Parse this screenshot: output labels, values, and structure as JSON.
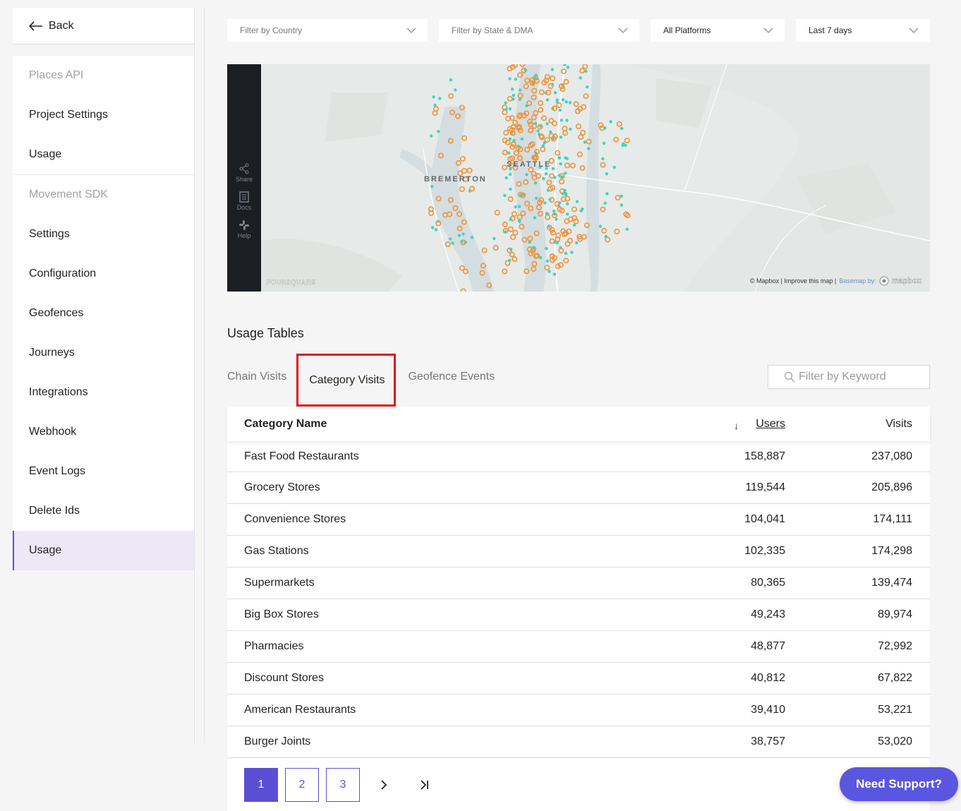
{
  "sidebar": {
    "back_label": "Back",
    "groups": [
      {
        "header": "Places API",
        "items": [
          "Project Settings",
          "Usage"
        ]
      },
      {
        "header": "Movement SDK",
        "items": [
          "Settings",
          "Configuration",
          "Geofences",
          "Journeys",
          "Integrations",
          "Webhook",
          "Event Logs",
          "Delete Ids",
          "Usage"
        ]
      }
    ],
    "active_item": "Usage"
  },
  "filters": {
    "country": "Filter by Country",
    "state_dma": "Filter by State & DMA",
    "platform": "All Platforms",
    "date_range": "Last 7 days"
  },
  "map": {
    "tools": [
      "Share",
      "Docs",
      "Help"
    ],
    "labels": {
      "bremerton": "BREMERTON",
      "seattle": "SEATTLE"
    },
    "watermark": "FOURSQUARE",
    "attribution": "© Mapbox | Improve this map |",
    "basemap": "Basemap by:",
    "mapbox": "mapbox",
    "colors": {
      "orange": "#f0923a",
      "teal": "#3fd4c0"
    }
  },
  "usage": {
    "title": "Usage Tables",
    "tabs": [
      "Chain Visits",
      "Category Visits",
      "Geofence Events"
    ],
    "active_tab": "Category Visits",
    "search_placeholder": "Filter by Keyword",
    "columns": {
      "name": "Category Name",
      "users": "Users",
      "visits": "Visits"
    },
    "rows": [
      {
        "name": "Fast Food Restaurants",
        "users": "158,887",
        "visits": "237,080"
      },
      {
        "name": "Grocery Stores",
        "users": "119,544",
        "visits": "205,896"
      },
      {
        "name": "Convenience Stores",
        "users": "104,041",
        "visits": "174,111"
      },
      {
        "name": "Gas Stations",
        "users": "102,335",
        "visits": "174,298"
      },
      {
        "name": "Supermarkets",
        "users": "80,365",
        "visits": "139,474"
      },
      {
        "name": "Big Box Stores",
        "users": "49,243",
        "visits": "89,974"
      },
      {
        "name": "Pharmacies",
        "users": "48,877",
        "visits": "72,992"
      },
      {
        "name": "Discount Stores",
        "users": "40,812",
        "visits": "67,822"
      },
      {
        "name": "American Restaurants",
        "users": "39,410",
        "visits": "53,221"
      },
      {
        "name": "Burger Joints",
        "users": "38,757",
        "visits": "53,020"
      }
    ],
    "pages": [
      "1",
      "2",
      "3"
    ],
    "current_page": "1"
  },
  "support_label": "Need Support?",
  "accent_color": "#5a4fd4",
  "highlight_color": "#e0141c"
}
